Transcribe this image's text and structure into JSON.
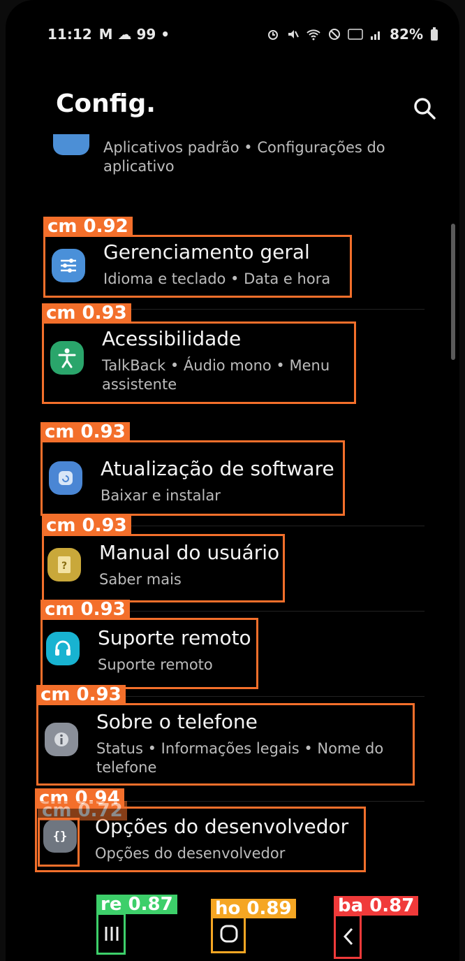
{
  "status": {
    "time": "11:12",
    "notif_icons": "M ☁ 99 •",
    "battery": "82%"
  },
  "page": {
    "title": "Config."
  },
  "partial_item": {
    "sub": "Aplicativos padrão • Configurações do aplicativo"
  },
  "items": [
    {
      "title": "Gerenciamento geral",
      "sub": "Idioma e teclado • Data e hora",
      "icon": "sliders-icon",
      "color": "#4a90d9"
    },
    {
      "title": "Acessibilidade",
      "sub": "TalkBack • Áudio mono • Menu assistente",
      "icon": "accessibility-icon",
      "color": "#2aa56b"
    },
    {
      "title": "Atualização de software",
      "sub": "Baixar e instalar",
      "icon": "software-update-icon",
      "color": "#4a86d4"
    },
    {
      "title": "Manual do usuário",
      "sub": "Saber mais",
      "icon": "manual-icon",
      "color": "#c9a83a"
    },
    {
      "title": "Suporte remoto",
      "sub": "Suporte remoto",
      "icon": "headset-icon",
      "color": "#18b3d1"
    },
    {
      "title": "Sobre o telefone",
      "sub": "Status • Informações legais • Nome do telefone",
      "icon": "info-icon",
      "color": "#8a8f99"
    },
    {
      "title": "Opções do desenvolvedor",
      "sub": "Opções do desenvolvedor",
      "icon": "developer-options-icon",
      "color": "#6f7680"
    }
  ],
  "detections": [
    {
      "label": "cm 0.92",
      "color": "#f36f2b"
    },
    {
      "label": "cm 0.93",
      "color": "#f36f2b"
    },
    {
      "label": "cm 0.93",
      "color": "#f36f2b"
    },
    {
      "label": "cm 0.93",
      "color": "#f36f2b"
    },
    {
      "label": "cm 0.93",
      "color": "#f36f2b"
    },
    {
      "label": "cm 0.93",
      "color": "#f36f2b"
    },
    {
      "label": "cm 0.94",
      "color": "#f36f2b"
    },
    {
      "label": "cm 0.72",
      "color": "#f36f2b"
    },
    {
      "label": "re 0.87",
      "color": "#3dcf6a"
    },
    {
      "label": "ho 0.89",
      "color": "#f5a623"
    },
    {
      "label": "ba 0.87",
      "color": "#f03a3a"
    }
  ],
  "navbar": {
    "recents": "recents-icon",
    "home": "home-icon",
    "back": "back-icon"
  }
}
